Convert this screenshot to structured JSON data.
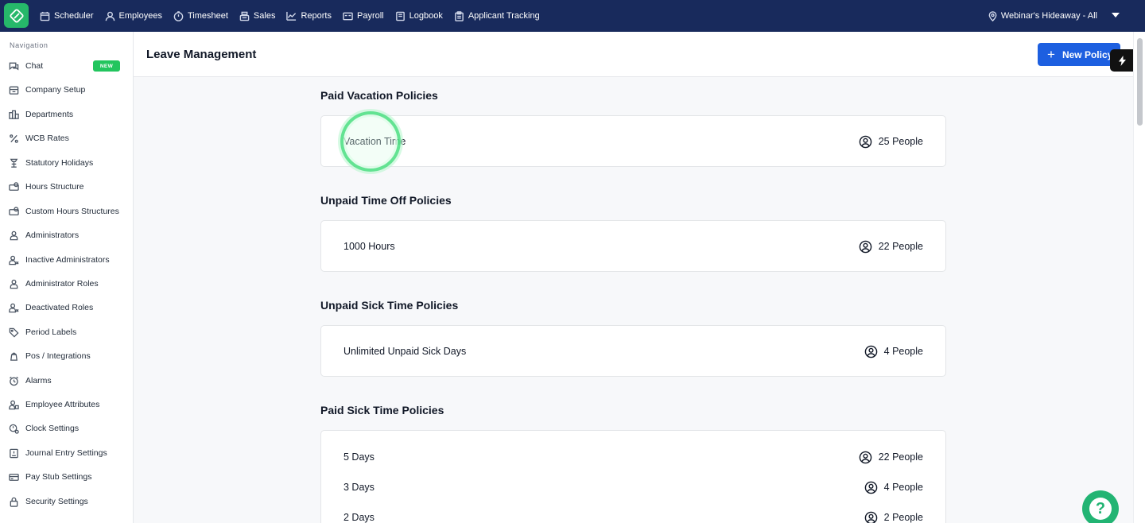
{
  "topbar": {
    "nav": [
      {
        "label": "Scheduler",
        "icon": "calendar-icon"
      },
      {
        "label": "Employees",
        "icon": "user-icon"
      },
      {
        "label": "Timesheet",
        "icon": "clock-icon"
      },
      {
        "label": "Sales",
        "icon": "register-icon"
      },
      {
        "label": "Reports",
        "icon": "chart-icon"
      },
      {
        "label": "Payroll",
        "icon": "payroll-icon"
      },
      {
        "label": "Logbook",
        "icon": "book-icon"
      },
      {
        "label": "Applicant Tracking",
        "icon": "clipboard-icon"
      }
    ],
    "location": "Webinar's Hideaway - All"
  },
  "sidebar": {
    "title": "Navigation",
    "badge": "NEW",
    "items": [
      {
        "label": "Chat",
        "icon": "chat-icon"
      },
      {
        "label": "Company Setup",
        "icon": "building-icon"
      },
      {
        "label": "Departments",
        "icon": "departments-icon"
      },
      {
        "label": "WCB Rates",
        "icon": "percent-icon"
      },
      {
        "label": "Statutory Holidays",
        "icon": "holiday-icon"
      },
      {
        "label": "Hours Structure",
        "icon": "hours-icon"
      },
      {
        "label": "Custom Hours Structures",
        "icon": "custom-hours-icon"
      },
      {
        "label": "Administrators",
        "icon": "admin-icon"
      },
      {
        "label": "Inactive Administrators",
        "icon": "inactive-admin-icon"
      },
      {
        "label": "Administrator Roles",
        "icon": "admin-role-icon"
      },
      {
        "label": "Deactivated Roles",
        "icon": "deactivated-role-icon"
      },
      {
        "label": "Period Labels",
        "icon": "tag-icon"
      },
      {
        "label": "Pos / Integrations",
        "icon": "integration-icon"
      },
      {
        "label": "Alarms",
        "icon": "alarm-icon"
      },
      {
        "label": "Employee Attributes",
        "icon": "attributes-icon"
      },
      {
        "label": "Clock Settings",
        "icon": "clock-settings-icon"
      },
      {
        "label": "Journal Entry Settings",
        "icon": "journal-icon"
      },
      {
        "label": "Pay Stub Settings",
        "icon": "pay-stub-icon"
      },
      {
        "label": "Security Settings",
        "icon": "lock-icon"
      }
    ]
  },
  "header": {
    "title": "Leave Management",
    "new_policy_label": "New Policy"
  },
  "sections": [
    {
      "title": "Paid Vacation Policies",
      "rows": [
        {
          "name": "Vacation Time",
          "people": "25 People"
        }
      ]
    },
    {
      "title": "Unpaid Time Off Policies",
      "rows": [
        {
          "name": "1000 Hours",
          "people": "22 People"
        }
      ]
    },
    {
      "title": "Unpaid Sick Time Policies",
      "rows": [
        {
          "name": "Unlimited Unpaid Sick Days",
          "people": "4 People"
        }
      ]
    },
    {
      "title": "Paid Sick Time Policies",
      "rows": [
        {
          "name": "5 Days",
          "people": "22 People"
        },
        {
          "name": "3 Days",
          "people": "4 People"
        },
        {
          "name": "2 Days",
          "people": "2 People"
        }
      ]
    }
  ],
  "colors": {
    "topbar": "#182a5c",
    "brand_green": "#26b86a",
    "primary_button": "#1d5fe0"
  }
}
